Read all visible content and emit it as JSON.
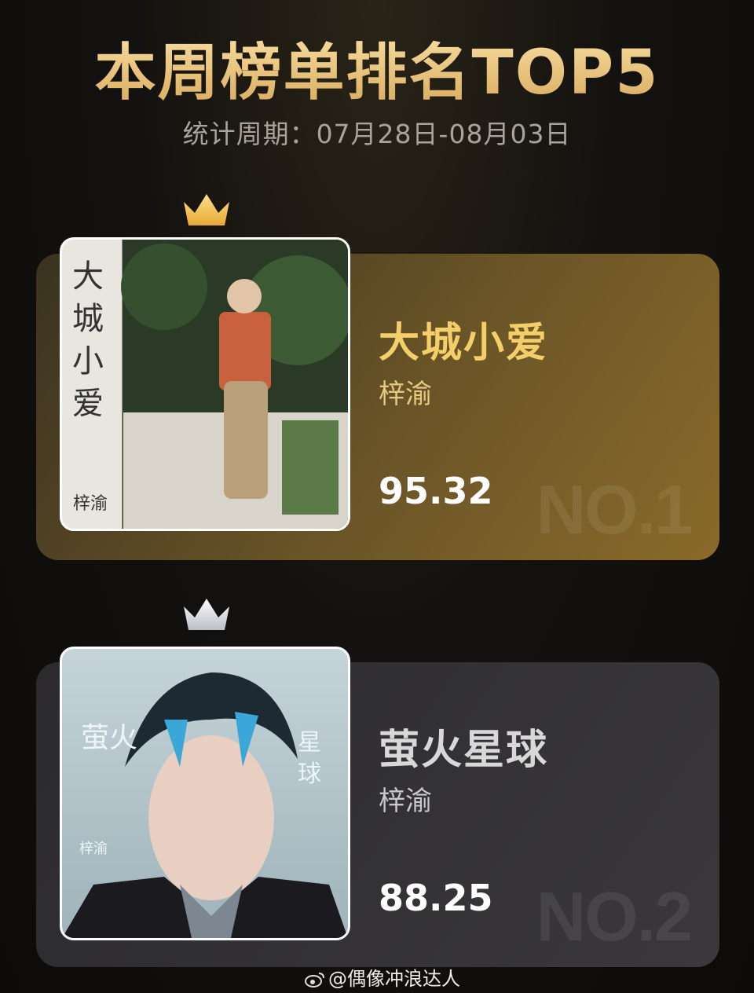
{
  "header": {
    "title": "本周榜单排名TOP5",
    "period": "统计周期：07月28日-08月03日"
  },
  "entries": [
    {
      "rank_label": "NO.1",
      "song": "大城小爱",
      "artist": "梓渝",
      "score": "95.32",
      "crown": "gold-crown-icon",
      "cover_text": [
        "大",
        "城",
        "小",
        "爱",
        "梓渝"
      ]
    },
    {
      "rank_label": "NO.2",
      "song": "萤火星球",
      "artist": "梓渝",
      "score": "88.25",
      "crown": "silver-crown-icon",
      "cover_text": [
        "萤火",
        "星球",
        "梓渝"
      ]
    }
  ],
  "watermark": "@偶像冲浪达人",
  "colors": {
    "gold": "#e8c37a",
    "silver_card": "#333135",
    "gold_card": "#6b5527"
  }
}
